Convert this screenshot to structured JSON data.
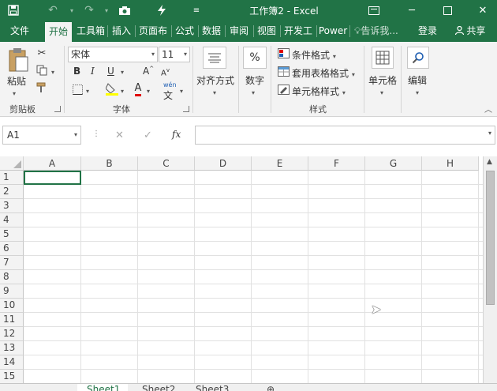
{
  "title": "工作簿2 - Excel",
  "tabs": [
    "文件",
    "开始",
    "工具箱",
    "插入",
    "页面布",
    "公式",
    "数据",
    "审阅",
    "视图",
    "开发工",
    "Power"
  ],
  "tell_me": "告诉我...",
  "login": "登录",
  "share": "共享",
  "ribbon": {
    "paste": "粘贴",
    "clipboard_label": "剪贴板",
    "font_name": "宋体",
    "font_size": "11",
    "font_label": "字体",
    "bold": "B",
    "italic": "I",
    "underline": "U",
    "grow_font": "A",
    "shrink_font": "A",
    "font_color": "A",
    "wen": "wén",
    "wen_char": "文",
    "alignment": "对齐方式",
    "number": "数字",
    "percent": "%",
    "cond_format": "条件格式",
    "table_format": "套用表格格式",
    "cell_styles": "单元格样式",
    "styles_label": "样式",
    "cells": "单元格",
    "editing": "编辑"
  },
  "formula_bar": {
    "name_box": "A1",
    "fx": "fx",
    "cancel": "✕",
    "enter": "✓"
  },
  "columns": [
    "A",
    "B",
    "C",
    "D",
    "E",
    "F",
    "G",
    "H"
  ],
  "rows": [
    "1",
    "2",
    "3",
    "4",
    "5",
    "6",
    "7",
    "8",
    "9",
    "10",
    "11",
    "12",
    "13",
    "14",
    "15"
  ],
  "sheets": [
    "Sheet1",
    "Sheet2",
    "Sheet3"
  ],
  "colors": {
    "accent": "#217346",
    "ribbon_bg": "#f3f3f3"
  }
}
